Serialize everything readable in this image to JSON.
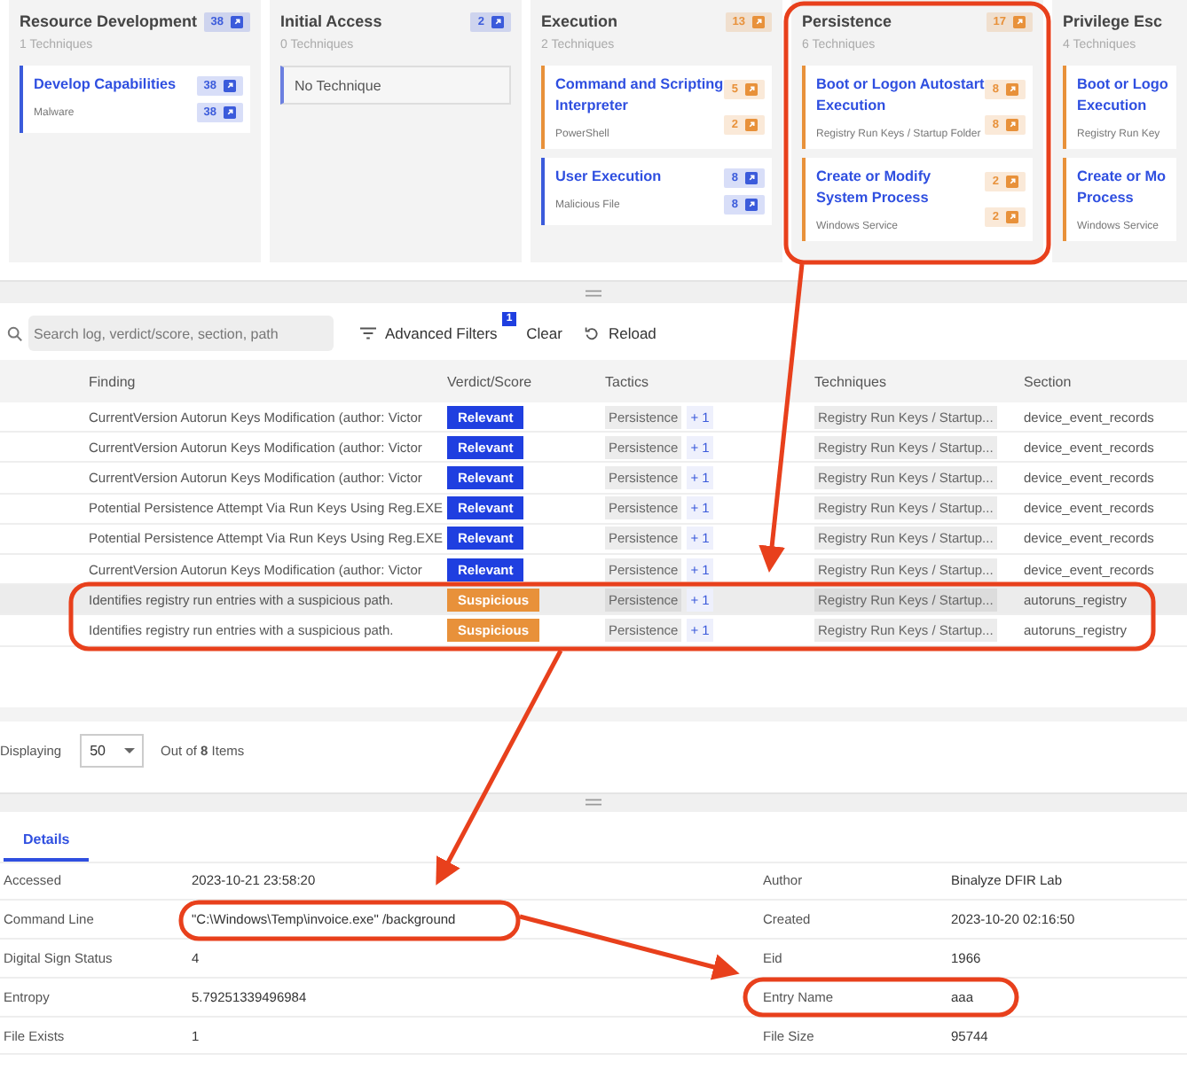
{
  "board": {
    "columns": [
      {
        "title": "Resource Development",
        "subtitle": "1 Techniques",
        "count": "38",
        "color": "#3b5bdb",
        "cards": [
          {
            "kind": "technique",
            "title": "Develop Capabilities",
            "subtitle": "Malware",
            "color": "#3b5bdb",
            "counts": [
              "38",
              "38"
            ]
          }
        ]
      },
      {
        "title": "Initial Access",
        "subtitle": "0 Techniques",
        "count": "2",
        "color": "#3b5bdb",
        "cards": [
          {
            "kind": "empty",
            "title": "No Technique"
          }
        ]
      },
      {
        "title": "Execution",
        "subtitle": "2 Techniques",
        "count": "13",
        "color": "#e8913a",
        "cards": [
          {
            "kind": "technique",
            "title": "Command and Scripting Interpreter",
            "subtitle": "PowerShell",
            "color": "#e8913a",
            "counts": [
              "5",
              "2"
            ]
          },
          {
            "kind": "technique",
            "title": "User Execution",
            "subtitle": "Malicious File",
            "color": "#3b5bdb",
            "counts": [
              "8",
              "8"
            ]
          }
        ]
      },
      {
        "title": "Persistence",
        "subtitle": "6 Techniques",
        "count": "17",
        "color": "#e8913a",
        "cards": [
          {
            "kind": "technique",
            "title": "Boot or Logon Autostart Execution",
            "subtitle": "Registry Run Keys / Startup Folder",
            "color": "#e8913a",
            "counts": [
              "8",
              "8"
            ]
          },
          {
            "kind": "technique",
            "title": "Create or Modify System Process",
            "subtitle": "Windows Service",
            "color": "#e8913a",
            "counts": [
              "2",
              "2"
            ]
          }
        ]
      },
      {
        "title": "Privilege Esc",
        "subtitle": "4 Techniques",
        "cards": [
          {
            "kind": "technique",
            "title": "Boot or Logo Execution",
            "subtitle": "Registry Run Key",
            "color": "#e8913a"
          },
          {
            "kind": "technique",
            "title": "Create or Mo Process",
            "subtitle": "Windows Service",
            "color": "#e8913a"
          }
        ]
      }
    ]
  },
  "toolbar": {
    "search_placeholder": "Search log, verdict/score, section, path",
    "advanced_filters": "Advanced Filters",
    "filter_count": "1",
    "clear": "Clear",
    "reload": "Reload"
  },
  "table": {
    "columns": [
      "Finding",
      "Verdict/Score",
      "Tactics",
      "Techniques",
      "Section"
    ],
    "rows": [
      {
        "finding": "CurrentVersion Autorun Keys Modification (author: Victor",
        "verdict": "Relevant",
        "kind": "relevant",
        "tactic": "Persistence",
        "more": "+ 1",
        "technique": "Registry Run Keys / Startup...",
        "section": "device_event_records",
        "selected": false
      },
      {
        "finding": "CurrentVersion Autorun Keys Modification (author: Victor",
        "verdict": "Relevant",
        "kind": "relevant",
        "tactic": "Persistence",
        "more": "+ 1",
        "technique": "Registry Run Keys / Startup...",
        "section": "device_event_records",
        "selected": false
      },
      {
        "finding": "CurrentVersion Autorun Keys Modification (author: Victor",
        "verdict": "Relevant",
        "kind": "relevant",
        "tactic": "Persistence",
        "more": "+ 1",
        "technique": "Registry Run Keys / Startup...",
        "section": "device_event_records",
        "selected": false
      },
      {
        "finding": "Potential Persistence Attempt Via Run Keys Using Reg.EXE",
        "verdict": "Relevant",
        "kind": "relevant",
        "tactic": "Persistence",
        "more": "+ 1",
        "technique": "Registry Run Keys / Startup...",
        "section": "device_event_records",
        "selected": false
      },
      {
        "finding": "Potential Persistence Attempt Via Run Keys Using Reg.EXE",
        "verdict": "Relevant",
        "kind": "relevant",
        "tactic": "Persistence",
        "more": "+ 1",
        "technique": "Registry Run Keys / Startup...",
        "section": "device_event_records",
        "selected": false
      },
      {
        "finding": "CurrentVersion Autorun Keys Modification (author: Victor",
        "verdict": "Relevant",
        "kind": "relevant",
        "tactic": "Persistence",
        "more": "+ 1",
        "technique": "Registry Run Keys / Startup...",
        "section": "device_event_records",
        "selected": false
      },
      {
        "finding": "Identifies registry run entries with a suspicious path.",
        "verdict": "Suspicious",
        "kind": "suspicious",
        "tactic": "Persistence",
        "more": "+ 1",
        "technique": "Registry Run Keys / Startup...",
        "section": "autoruns_registry",
        "selected": true
      },
      {
        "finding": "Identifies registry run entries with a suspicious path.",
        "verdict": "Suspicious",
        "kind": "suspicious",
        "tactic": "Persistence",
        "more": "+ 1",
        "technique": "Registry Run Keys / Startup...",
        "section": "autoruns_registry",
        "selected": false
      }
    ]
  },
  "pagination": {
    "label": "Displaying",
    "page_size": "50",
    "summary": "Out of **8** Items"
  },
  "details": {
    "tabs": [
      {
        "label": "Details",
        "selected": true
      }
    ],
    "left": [
      {
        "label": "Accessed",
        "value": "2023-10-21 23:58:20"
      },
      {
        "label": "Command Line",
        "value": "\"C:\\Windows\\Temp\\invoice.exe\" /background"
      },
      {
        "label": "Digital Sign Status",
        "value": "4"
      },
      {
        "label": "Entropy",
        "value": "5.79251339496984"
      },
      {
        "label": "File Exists",
        "value": "1"
      }
    ],
    "right": [
      {
        "label": "Author",
        "value": "Binalyze DFIR Lab"
      },
      {
        "label": "Created",
        "value": "2023-10-20 02:16:50"
      },
      {
        "label": "Eid",
        "value": "1966"
      },
      {
        "label": "Entry Name",
        "value": "aaa"
      },
      {
        "label": "File Size",
        "value": "95744"
      }
    ]
  }
}
